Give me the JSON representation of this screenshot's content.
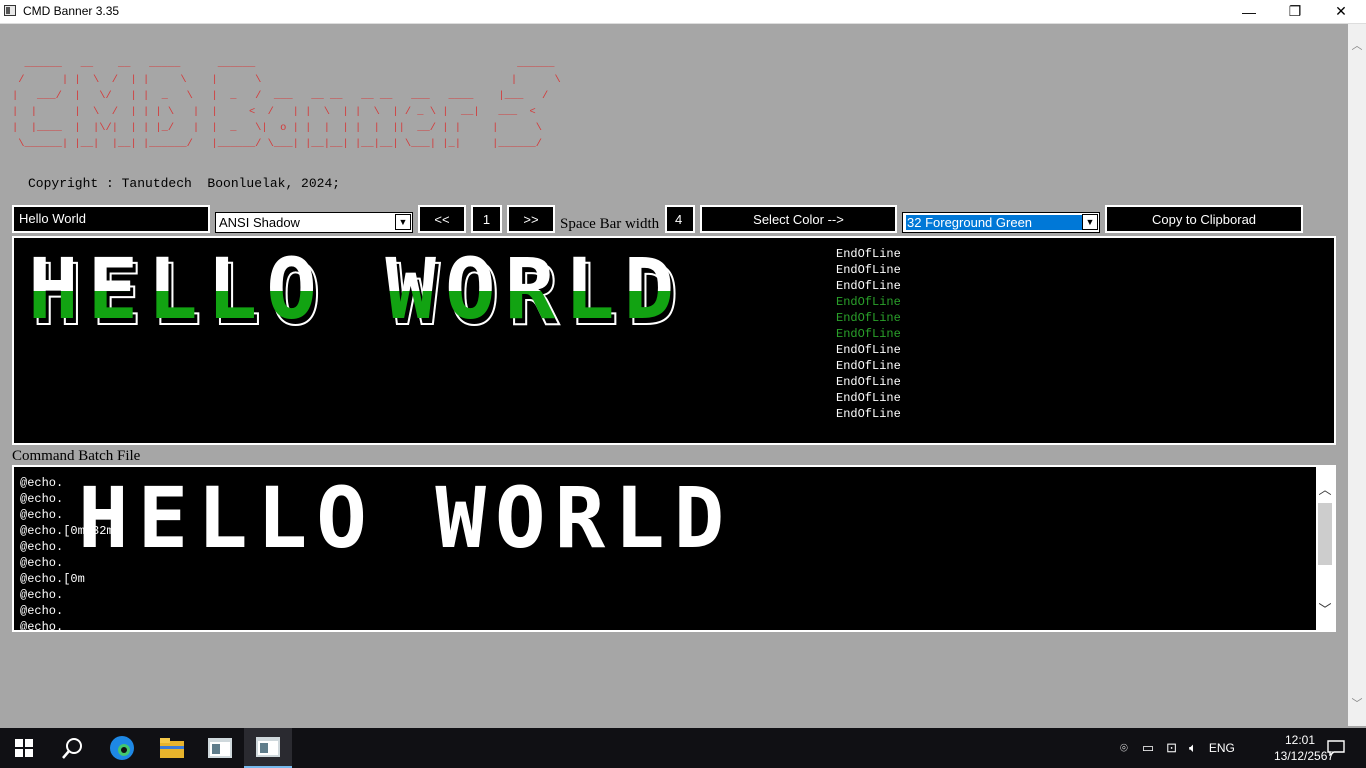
{
  "window": {
    "title": "CMD Banner 3.35",
    "minimize": "—",
    "maximize": "❐",
    "close": "✕"
  },
  "banner": {
    "art_lines": [
      "  ______   __    __   _____      ______                                          ______",
      " /      | |  \\  /  | |     \\    |      \\                                        |      \\",
      "|   ___/  |   \\/   | |  _   \\   |  _   /  ___   __ __   __ __   ___   ____    |___   /",
      "|  |      |  \\  /  | | | \\   |  |     <  /   | |  \\  | |  \\  | / _ \\ |  __|   ___  <",
      "|  |____  |  |\\/|  | | |_/   |  |  _   \\|  o | |  |  | |  |  ||  __/ | |     |      \\",
      " \\______| |__|  |__| |______/   |______/ \\___| |__|__| |__|__| \\___| |_|     |______/"
    ]
  },
  "copyright": "Copyright : Tanutdech  Boonluelak, 2024;",
  "controls": {
    "input_text": "Hello World",
    "font_select": "ANSI Shadow",
    "prev_button": "<<",
    "page_number": "1",
    "next_button": ">>",
    "space_label": "Space Bar width",
    "space_value": "4",
    "select_color_button": "Select Color -->",
    "color_select": "32 Foreground Green",
    "copy_button": "Copy to Clipborad"
  },
  "preview": {
    "banner_text": "HELLO WORLD",
    "eol_lines": [
      "EndOfLine",
      "EndOfLine",
      "EndOfLine",
      "EndOfLine",
      "EndOfLine",
      "EndOfLine",
      "EndOfLine",
      "EndOfLine",
      "EndOfLine",
      "EndOfLine",
      "EndOfLine"
    ],
    "green_rows": [
      3,
      4,
      5
    ]
  },
  "command": {
    "label": "Command Batch File",
    "lines": [
      "@echo.",
      "@echo.",
      "@echo.",
      "@echo.[0m[32m",
      "@echo.",
      "@echo.",
      "@echo.[0m",
      "@echo.",
      "@echo.",
      "@echo."
    ]
  },
  "taskbar": {
    "lang": "ENG",
    "time": "12:01",
    "date": "13/12/2567"
  },
  "colors": {
    "background": "#a6a6a6",
    "banner_red": "#d33a3a",
    "green": "#12a312",
    "selected": "#0078d7"
  }
}
